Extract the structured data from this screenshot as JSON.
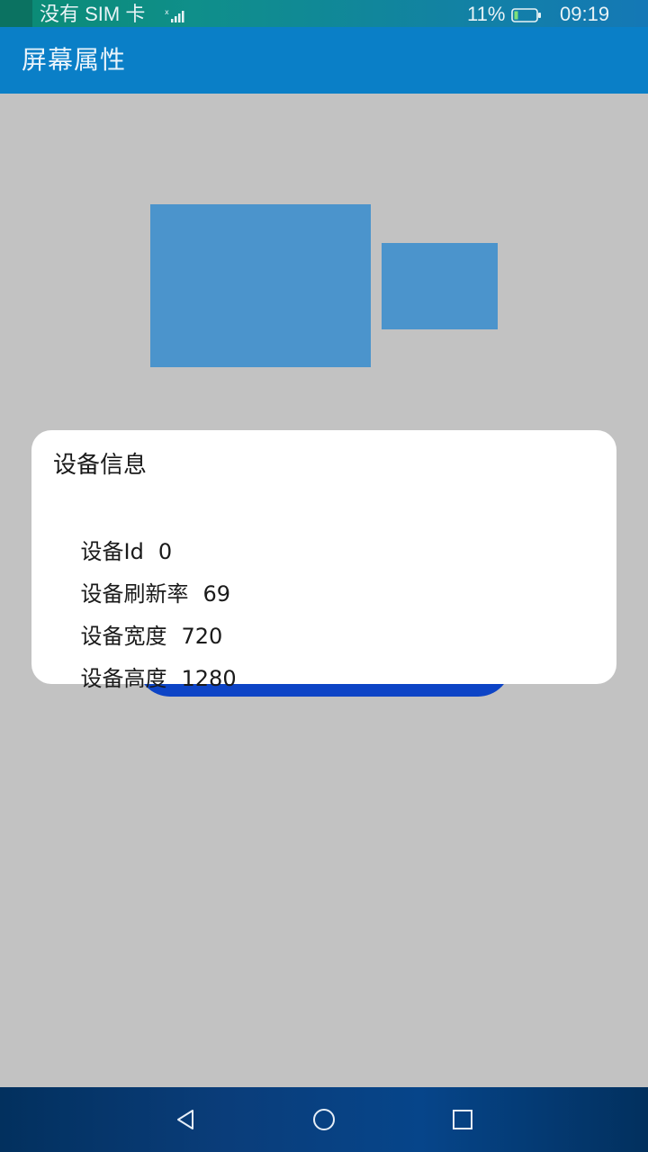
{
  "status_bar": {
    "carrier": "没有 SIM 卡",
    "battery": "11%",
    "time": "09:19",
    "icons": [
      "signal-icon",
      "battery-icon"
    ]
  },
  "app_bar": {
    "title": "屏幕属性",
    "color": "#0a7fc7"
  },
  "content": {
    "accent_color": "#4b94cc",
    "button_color": "#0d44c6"
  },
  "dialog": {
    "title": "设备信息",
    "rows": [
      {
        "label": "设备Id",
        "value": "0"
      },
      {
        "label": "设备刷新率",
        "value": "69"
      },
      {
        "label": "设备宽度",
        "value": "720"
      },
      {
        "label": "设备高度",
        "value": "1280"
      }
    ]
  },
  "nav_bar": {
    "buttons": [
      "back-icon",
      "home-icon",
      "recent-apps-icon"
    ]
  }
}
